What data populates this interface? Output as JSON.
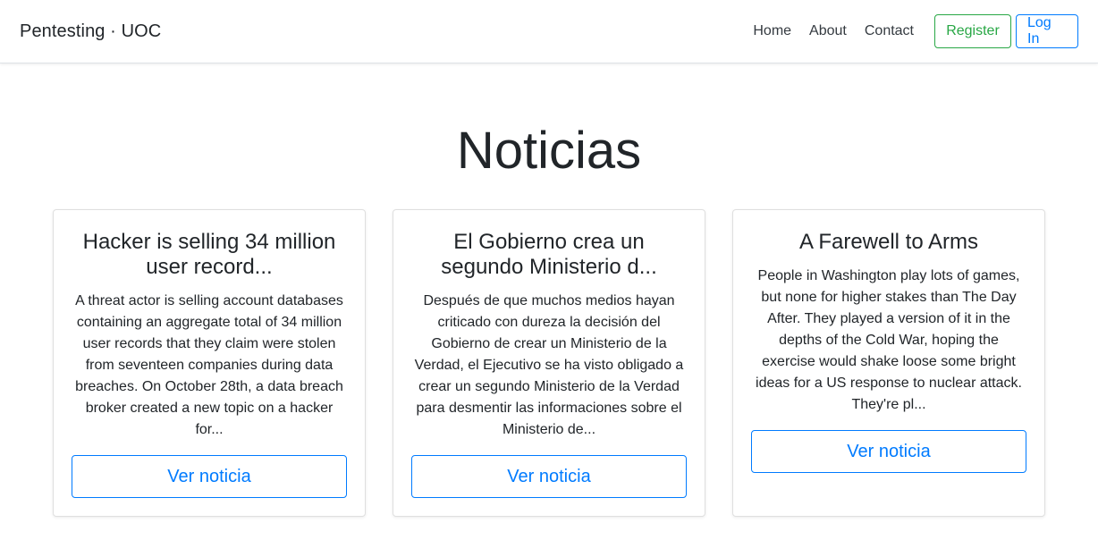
{
  "navbar": {
    "brand": "Pentesting · UOC",
    "links": [
      "Home",
      "About",
      "Contact"
    ],
    "register_label": "Register",
    "login_label": "Log In"
  },
  "main": {
    "heading": "Noticias",
    "cards": [
      {
        "title": "Hacker is selling 34 million user record...",
        "text": "A threat actor is selling account databases containing an aggregate total of 34 million user records that they claim were stolen from seventeen companies during data breaches. On October 28th, a data breach broker created a new topic on a hacker for...",
        "button": "Ver noticia"
      },
      {
        "title": "El Gobierno crea un segundo Ministerio d...",
        "text": "Después de que muchos medios hayan criticado con dureza la decisión del Gobierno de crear un Ministerio de la Verdad, el Ejecutivo se ha visto obligado a crear un segundo Ministerio de la Verdad para desmentir las informaciones sobre el Ministerio de...",
        "button": "Ver noticia"
      },
      {
        "title": "A Farewell to Arms",
        "text": "People in Washington play lots of games, but none for higher stakes than The Day After. They played a version of it in the depths of the Cold War, hoping the exercise would shake loose some bright ideas for a US response to nuclear attack. They're pl...",
        "button": "Ver noticia"
      }
    ]
  },
  "colors": {
    "primary": "#007bff",
    "success": "#28a745",
    "text": "#212529"
  }
}
